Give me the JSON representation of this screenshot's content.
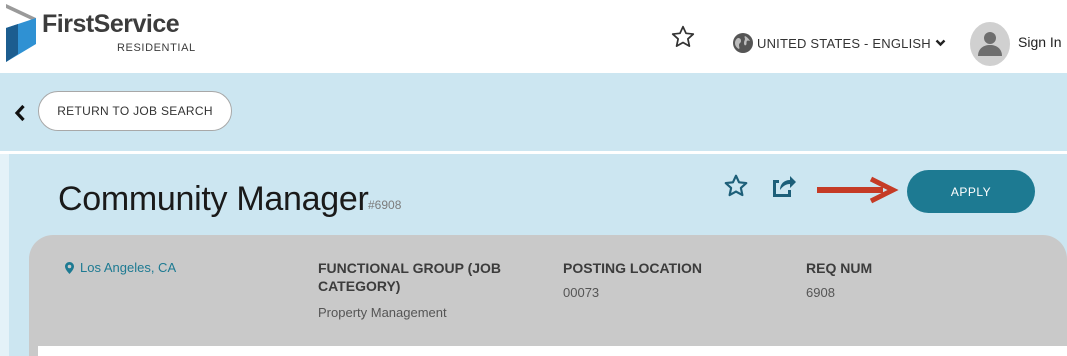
{
  "brand": {
    "name": "FirstService",
    "sub": "RESIDENTIAL",
    "colors": {
      "blue": "#2f91d3",
      "dark_blue": "#1c5d8f"
    }
  },
  "header": {
    "language_label": "UNITED STATES - ENGLISH",
    "sign_in": "Sign In",
    "icons": [
      "star-icon",
      "globe-icon",
      "chevron-down-icon",
      "user-icon"
    ]
  },
  "nav": {
    "return_label": "RETURN TO JOB SEARCH"
  },
  "job": {
    "title": "Community Manager",
    "req_tag": "#6908",
    "apply_label": "APPLY",
    "location": "Los Angeles, CA",
    "functional_group_label_1": "FUNCTIONAL GROUP (JOB",
    "functional_group_label_2": "CATEGORY)",
    "functional_group_value": "Property Management",
    "posting_location_label": "POSTING LOCATION",
    "posting_location_value": "00073",
    "req_num_label": "REQ NUM",
    "req_num_value": "6908"
  },
  "colors": {
    "panel_bg": "#cce6f1",
    "card_bg": "#c9c9c9",
    "accent": "#1d7a92",
    "arrow": "#c53b26"
  }
}
